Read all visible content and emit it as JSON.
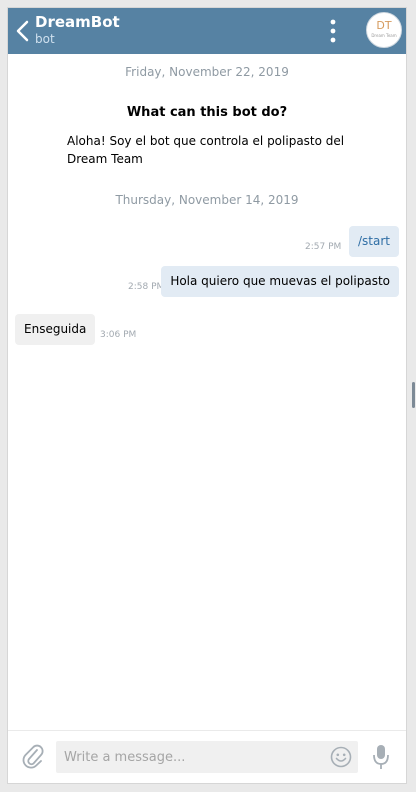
{
  "header": {
    "title": "DreamBot",
    "subtitle": "bot",
    "avatar_text": "DT",
    "avatar_subtext": "Dream Team"
  },
  "date_separators": [
    "Friday, November 22, 2019",
    "Thursday, November 14, 2019"
  ],
  "intro": {
    "title": "What can this bot do?",
    "text": "Aloha! Soy el bot que controla el polipasto del Dream Team"
  },
  "messages": [
    {
      "direction": "out",
      "text": "/start",
      "time": "2:57 PM"
    },
    {
      "direction": "out",
      "text": "Hola quiero que muevas el polipasto",
      "time": "2:58 PM"
    },
    {
      "direction": "in",
      "text": "Enseguida",
      "time": "3:06 PM"
    }
  ],
  "composer": {
    "placeholder": "Write a message..."
  },
  "colors": {
    "header": "#5682a3",
    "outgoing_bubble": "#e2ebf4",
    "incoming_bubble": "#f0f0f0",
    "link": "#2f6ea5"
  },
  "icons": [
    "back-arrow-icon",
    "more-vertical-icon",
    "attach-icon",
    "emoji-icon",
    "microphone-icon"
  ]
}
